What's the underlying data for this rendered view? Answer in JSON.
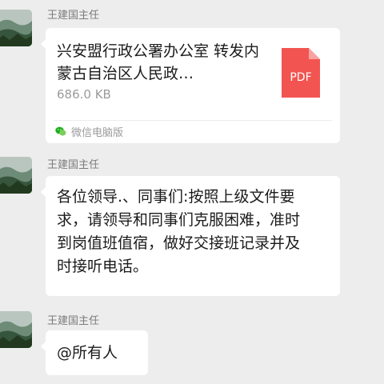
{
  "messages": [
    {
      "sender": "王建国主任",
      "type": "file",
      "file": {
        "title": "兴安盟行政公署办公室 转发内蒙古自治区人民政…",
        "size": "686.0 KB",
        "file_type": "PDF",
        "source": "微信电脑版",
        "icon": "pdf-file-icon",
        "icon_color": "#f25551"
      }
    },
    {
      "sender": "王建国主任",
      "type": "text",
      "text": "各位领导.、同事们:按照上级文件要求，请领导和同事们克服困难，准时到岗值班值宿，做好交接班记录并及时接听电话。"
    },
    {
      "sender": "王建国主任",
      "type": "text",
      "text": "@所有人"
    }
  ],
  "colors": {
    "background": "#ededed",
    "bubble": "#ffffff",
    "sender_text": "#7b7b7b",
    "source_icon": "#1aad19"
  }
}
